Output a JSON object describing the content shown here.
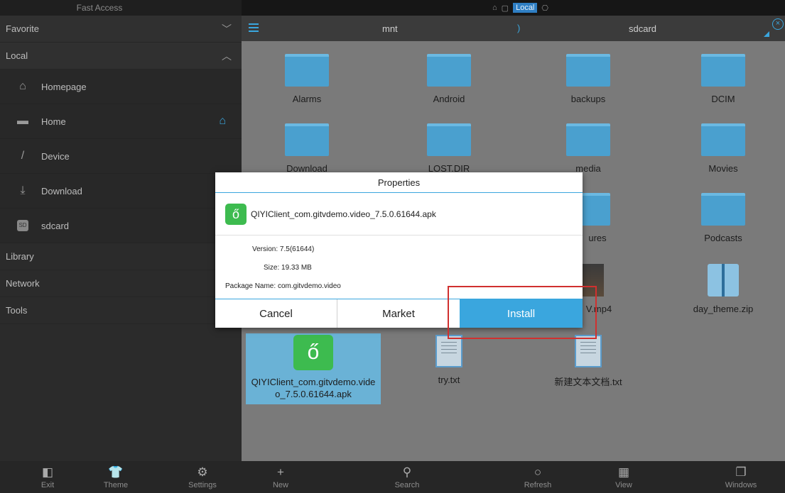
{
  "sidebar": {
    "title": "Fast Access",
    "sections": [
      {
        "label": "Favorite"
      },
      {
        "label": "Local"
      },
      {
        "label": "Library"
      },
      {
        "label": "Network"
      },
      {
        "label": "Tools"
      }
    ],
    "items": [
      {
        "label": "Homepage",
        "icon": "house-icon"
      },
      {
        "label": "Home",
        "icon": "folder-icon"
      },
      {
        "label": "Device",
        "icon": "slash-icon"
      },
      {
        "label": "Download",
        "icon": "download-icon"
      },
      {
        "label": "sdcard",
        "icon": "sd-card-icon"
      }
    ]
  },
  "topbar": {
    "badge": "Local"
  },
  "pathbar": {
    "crumb1": "mnt",
    "crumb2": "sdcard"
  },
  "files": [
    {
      "name": "Alarms",
      "type": "folder"
    },
    {
      "name": "Android",
      "type": "folder"
    },
    {
      "name": "backups",
      "type": "folder"
    },
    {
      "name": "DCIM",
      "type": "folder"
    },
    {
      "name": "Download",
      "type": "folder"
    },
    {
      "name": "LOST.DIR",
      "type": "folder"
    },
    {
      "name": "media",
      "type": "folder"
    },
    {
      "name": "Movies",
      "type": "folder"
    },
    {
      "name": "ures",
      "type": "folder"
    },
    {
      "name": "Podcasts",
      "type": "folder"
    },
    {
      "name": "V.mp4",
      "type": "video"
    },
    {
      "name": "day_theme.zip",
      "type": "zip"
    },
    {
      "name": "QIYIClient_com.gitvdemo.video_7.5.0.61644.apk",
      "type": "apk"
    },
    {
      "name": "try.txt",
      "type": "txt"
    },
    {
      "name": "新建文本文档.txt",
      "type": "txt"
    }
  ],
  "dialog": {
    "title": "Properties",
    "app_name": "QIYIClient_com.gitvdemo.video_7.5.0.61644.apk",
    "version_label": "Version:",
    "version_value": "7.5(61644)",
    "size_label": "Size:",
    "size_value": "19.33 MB",
    "package_label": "Package Name:",
    "package_value": "com.gitvdemo.video",
    "cancel": "Cancel",
    "market": "Market",
    "install": "Install"
  },
  "bottombar": [
    {
      "label": "Exit",
      "icon": "exit-icon"
    },
    {
      "label": "Theme",
      "icon": "shirt-icon"
    },
    {
      "label": "Settings",
      "icon": "gear-icon"
    },
    {
      "label": "New",
      "icon": "plus-icon"
    },
    {
      "label": "Search",
      "icon": "search-icon"
    },
    {
      "label": "Refresh",
      "icon": "refresh-icon"
    },
    {
      "label": "View",
      "icon": "grid-icon"
    },
    {
      "label": "Windows",
      "icon": "windows-icon"
    }
  ],
  "colors": {
    "accent": "#3aa6de",
    "highlight_frame": "#d0302f",
    "apk_green": "#3dbb4f"
  }
}
